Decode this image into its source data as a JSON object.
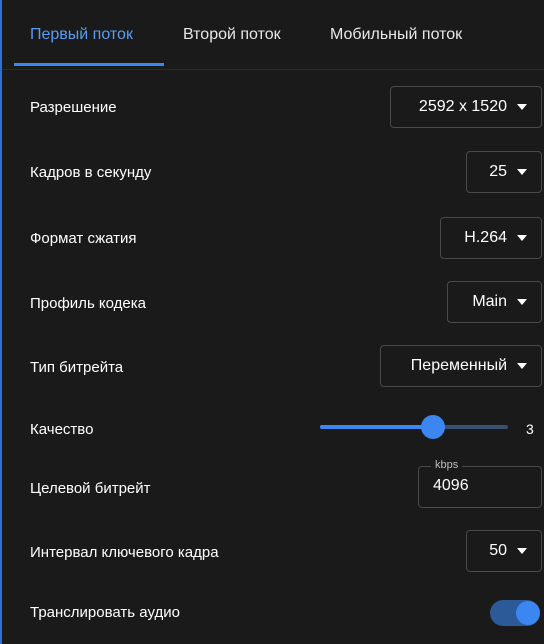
{
  "tabs": [
    {
      "label": "Первый поток",
      "active": true
    },
    {
      "label": "Второй поток",
      "active": false
    },
    {
      "label": "Мобильный поток",
      "active": false
    }
  ],
  "settings": {
    "resolution": {
      "label": "Разрешение",
      "value": "2592 x 1520"
    },
    "fps": {
      "label": "Кадров в секунду",
      "value": "25"
    },
    "codec": {
      "label": "Формат сжатия",
      "value": "H.264"
    },
    "profile": {
      "label": "Профиль кодека",
      "value": "Main"
    },
    "bitrate_type": {
      "label": "Тип битрейта",
      "value": "Переменный"
    },
    "quality": {
      "label": "Качество",
      "value": "3",
      "fraction": 0.6
    },
    "target_bitrate": {
      "label": "Целевой битрейт",
      "unit": "kbps",
      "value": "4096"
    },
    "keyframe_interval": {
      "label": "Интервал ключевого кадра",
      "value": "50"
    },
    "audio": {
      "label": "Транслировать аудио",
      "enabled": true
    }
  },
  "colors": {
    "accent": "#3b86f0",
    "background": "#1a1a1a",
    "border": "#4a4a4a"
  },
  "icons": {
    "dropdown": "caret-down-icon"
  }
}
